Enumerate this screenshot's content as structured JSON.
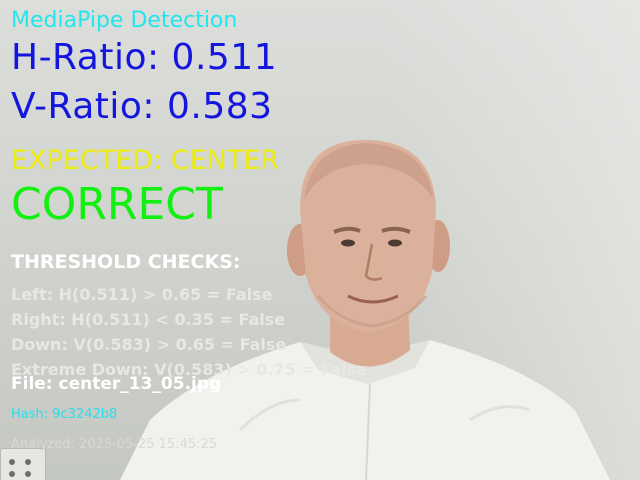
{
  "overlay": {
    "title": "MediaPipe Detection",
    "h_ratio": "H-Ratio: 0.511",
    "v_ratio": "V-Ratio: 0.583",
    "expected": "EXPECTED: CENTER",
    "result": "CORRECT",
    "checks_title": "THRESHOLD CHECKS:",
    "checks": [
      "Left: H(0.511) > 0.65 = False",
      "Right: H(0.511) < 0.35 = False",
      "Down: V(0.583) > 0.65 = False",
      "Extreme Down: V(0.583) > 0.75 = False"
    ],
    "file": "File: center_13_05.jpg",
    "hash": "Hash: 9c3242b8",
    "analyzed": "Analyzed: 2025-05-25 15:45:25"
  },
  "colors": {
    "title": "#22e6ec",
    "ratio": "#1515e0",
    "expected": "#ecec10",
    "result": "#12f012",
    "hash": "#27e0ea"
  }
}
